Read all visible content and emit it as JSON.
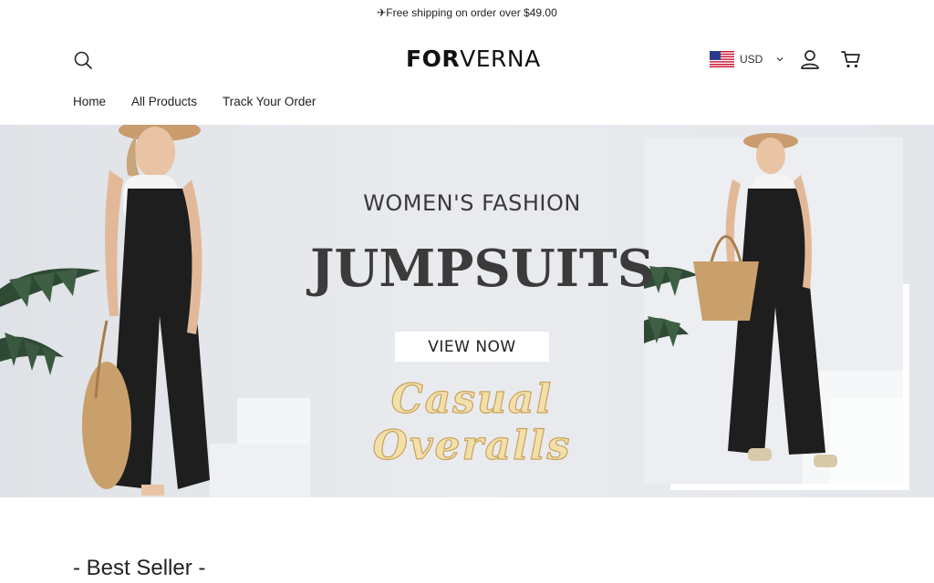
{
  "announcement": "✈Free shipping on order over $49.00",
  "brand": {
    "bold": "FOR",
    "light": "VERNA"
  },
  "currency": {
    "code": "USD",
    "flag": "us-flag-icon"
  },
  "nav": {
    "items": [
      "Home",
      "All Products",
      "Track Your Order"
    ]
  },
  "hero": {
    "subtitle": "WOMEN'S FASHION",
    "title": "JUMPSUITS",
    "cta": "VIEW NOW",
    "script": "Casual  Overalls"
  },
  "sections": {
    "best_seller": "- Best Seller -"
  },
  "colors": {
    "hero_bg": "#e6e8ec",
    "text": "#222222",
    "script_gold": "#caa35a"
  }
}
